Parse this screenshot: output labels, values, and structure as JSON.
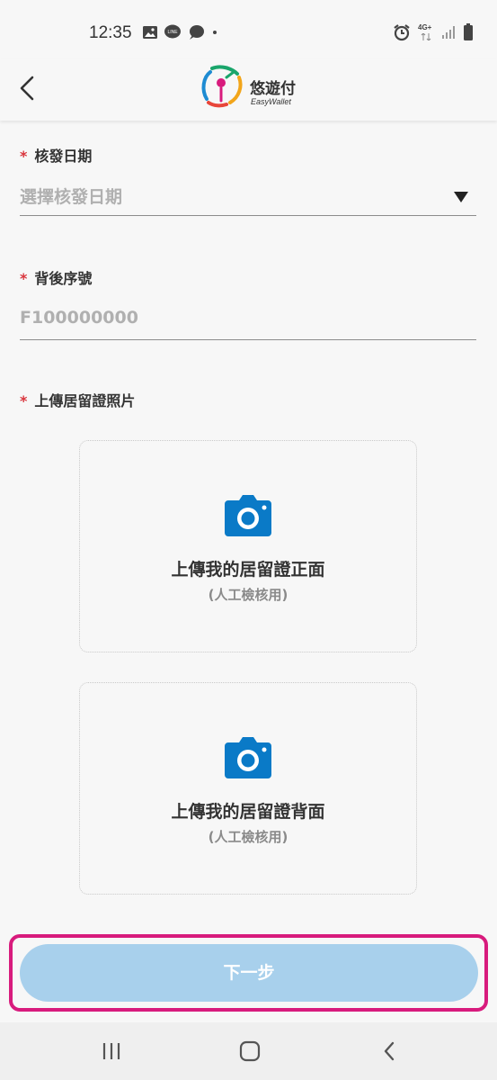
{
  "status_bar": {
    "time": "12:35",
    "left_icons": [
      "image-icon",
      "line-icon",
      "chat-icon",
      "dot-icon"
    ],
    "right_icons": [
      "alarm-icon",
      "4g-icon",
      "signal-icon",
      "battery-icon"
    ],
    "network": "4G+"
  },
  "header": {
    "logo_text": "悠遊付",
    "logo_subtext": "EasyWallet"
  },
  "form": {
    "required_mark": "*",
    "issue_date": {
      "label": "核發日期",
      "placeholder": "選擇核發日期"
    },
    "serial": {
      "label": "背後序號",
      "placeholder": "F100000000"
    },
    "upload": {
      "label": "上傳居留證照片",
      "front_title": "上傳我的居留證正面",
      "back_title": "上傳我的居留證背面",
      "note": "(人工檢核用)"
    }
  },
  "actions": {
    "next_label": "下一步"
  },
  "colors": {
    "accent": "#0a7ac7",
    "required": "#d9343c",
    "button_disabled": "#a8d0ec",
    "highlight": "#d81b7d"
  }
}
